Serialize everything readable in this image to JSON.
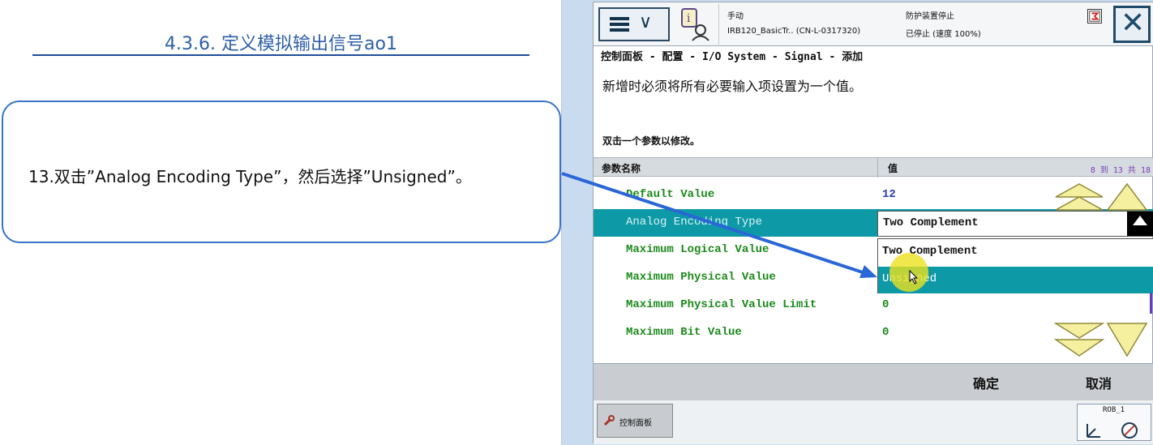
{
  "slide": {
    "title": "4.3.6. 定义模拟输出信号ao1",
    "instruction": "13.双击”Analog Encoding Type”，然后选择”Unsigned”。"
  },
  "pendant": {
    "status": {
      "mode": "手动",
      "controller": "IRB120_BasicTr..  (CN-L-0317320)",
      "guard": "防护装置停止",
      "state": "已停止 (速度 100%)"
    },
    "breadcrumb": "控制面板 - 配置 - I/O System - Signal - 添加",
    "instruction": "新增时必须将所有必要输入项设置为一个值。",
    "hint": "双击一个参数以修改。",
    "table": {
      "col_name": "参数名称",
      "col_value": "值",
      "page_info": "8 到 13 共 18",
      "rows": [
        {
          "name": "Default Value",
          "value": "12"
        },
        {
          "name": "Analog Encoding Type",
          "value": ""
        },
        {
          "name": "Maximum Logical Value",
          "value": ""
        },
        {
          "name": "Maximum Physical Value",
          "value": ""
        },
        {
          "name": "Maximum Physical Value Limit",
          "value": "0"
        },
        {
          "name": "Maximum Bit Value",
          "value": "0"
        }
      ]
    },
    "dropdown": {
      "selected": "Two Complement",
      "options": [
        "Two Complement",
        "Unsigned"
      ],
      "highlighted": "Unsigned"
    },
    "buttons": {
      "ok": "确定",
      "cancel": "取消"
    },
    "taskbar": {
      "task": "控制面板",
      "robot": "ROB_1"
    },
    "colors": {
      "selection": "#0d9aa6",
      "param_text": "#1b8a1b",
      "arrow": "#2a66d6",
      "nav_arrows": "#f5f0a0"
    }
  }
}
